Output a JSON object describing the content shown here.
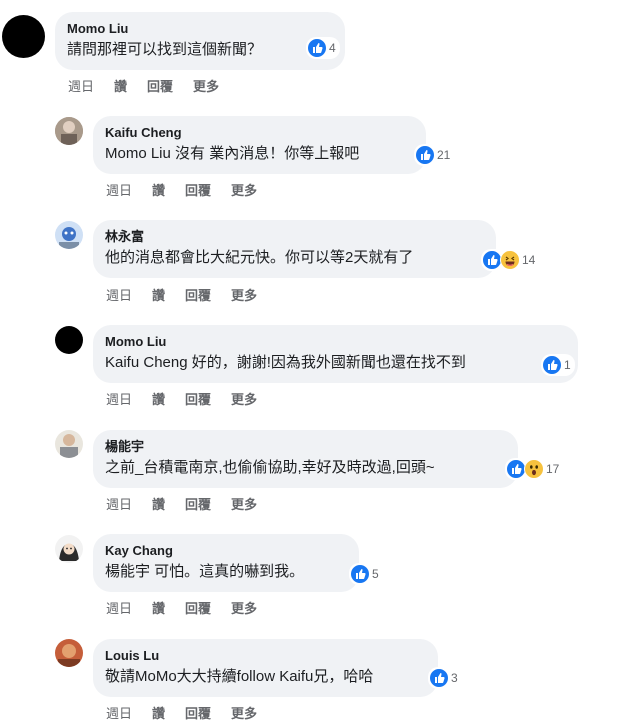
{
  "action_labels": {
    "date": "週日",
    "like": "讚",
    "reply": "回覆",
    "more": "更多"
  },
  "comments": [
    {
      "author": "Momo Liu",
      "text": "請問那裡可以找到這個新聞？",
      "count": "4",
      "reactions": [
        "like"
      ]
    },
    {
      "author": "Kaifu Cheng",
      "text": "Momo Liu 沒有 業內消息！你等上報吧",
      "count": "21",
      "reactions": [
        "like"
      ]
    },
    {
      "author": "林永富",
      "text": "他的消息都會比大紀元快。你可以等2天就有了",
      "count": "14",
      "reactions": [
        "like",
        "haha"
      ]
    },
    {
      "author": "Momo Liu",
      "text": "Kaifu Cheng 好的，謝謝!因為我外國新聞也還在找不到",
      "count": "1",
      "reactions": [
        "like"
      ]
    },
    {
      "author": "楊能宇",
      "text": "之前_台積電南京,也偷偷協助,幸好及時改過,回頭~",
      "count": "17",
      "reactions": [
        "like",
        "wow"
      ]
    },
    {
      "author": "Kay Chang",
      "text": "楊能宇 可怕。這真的嚇到我。",
      "count": "5",
      "reactions": [
        "like"
      ]
    },
    {
      "author": "Louis Lu",
      "text": "敬請MoMo大大持續follow Kaifu兄，哈哈",
      "count": "3",
      "reactions": [
        "like"
      ]
    }
  ],
  "colors": {
    "bubble": "#f0f2f5",
    "like": "#1877f2",
    "meta": "#65676b"
  }
}
